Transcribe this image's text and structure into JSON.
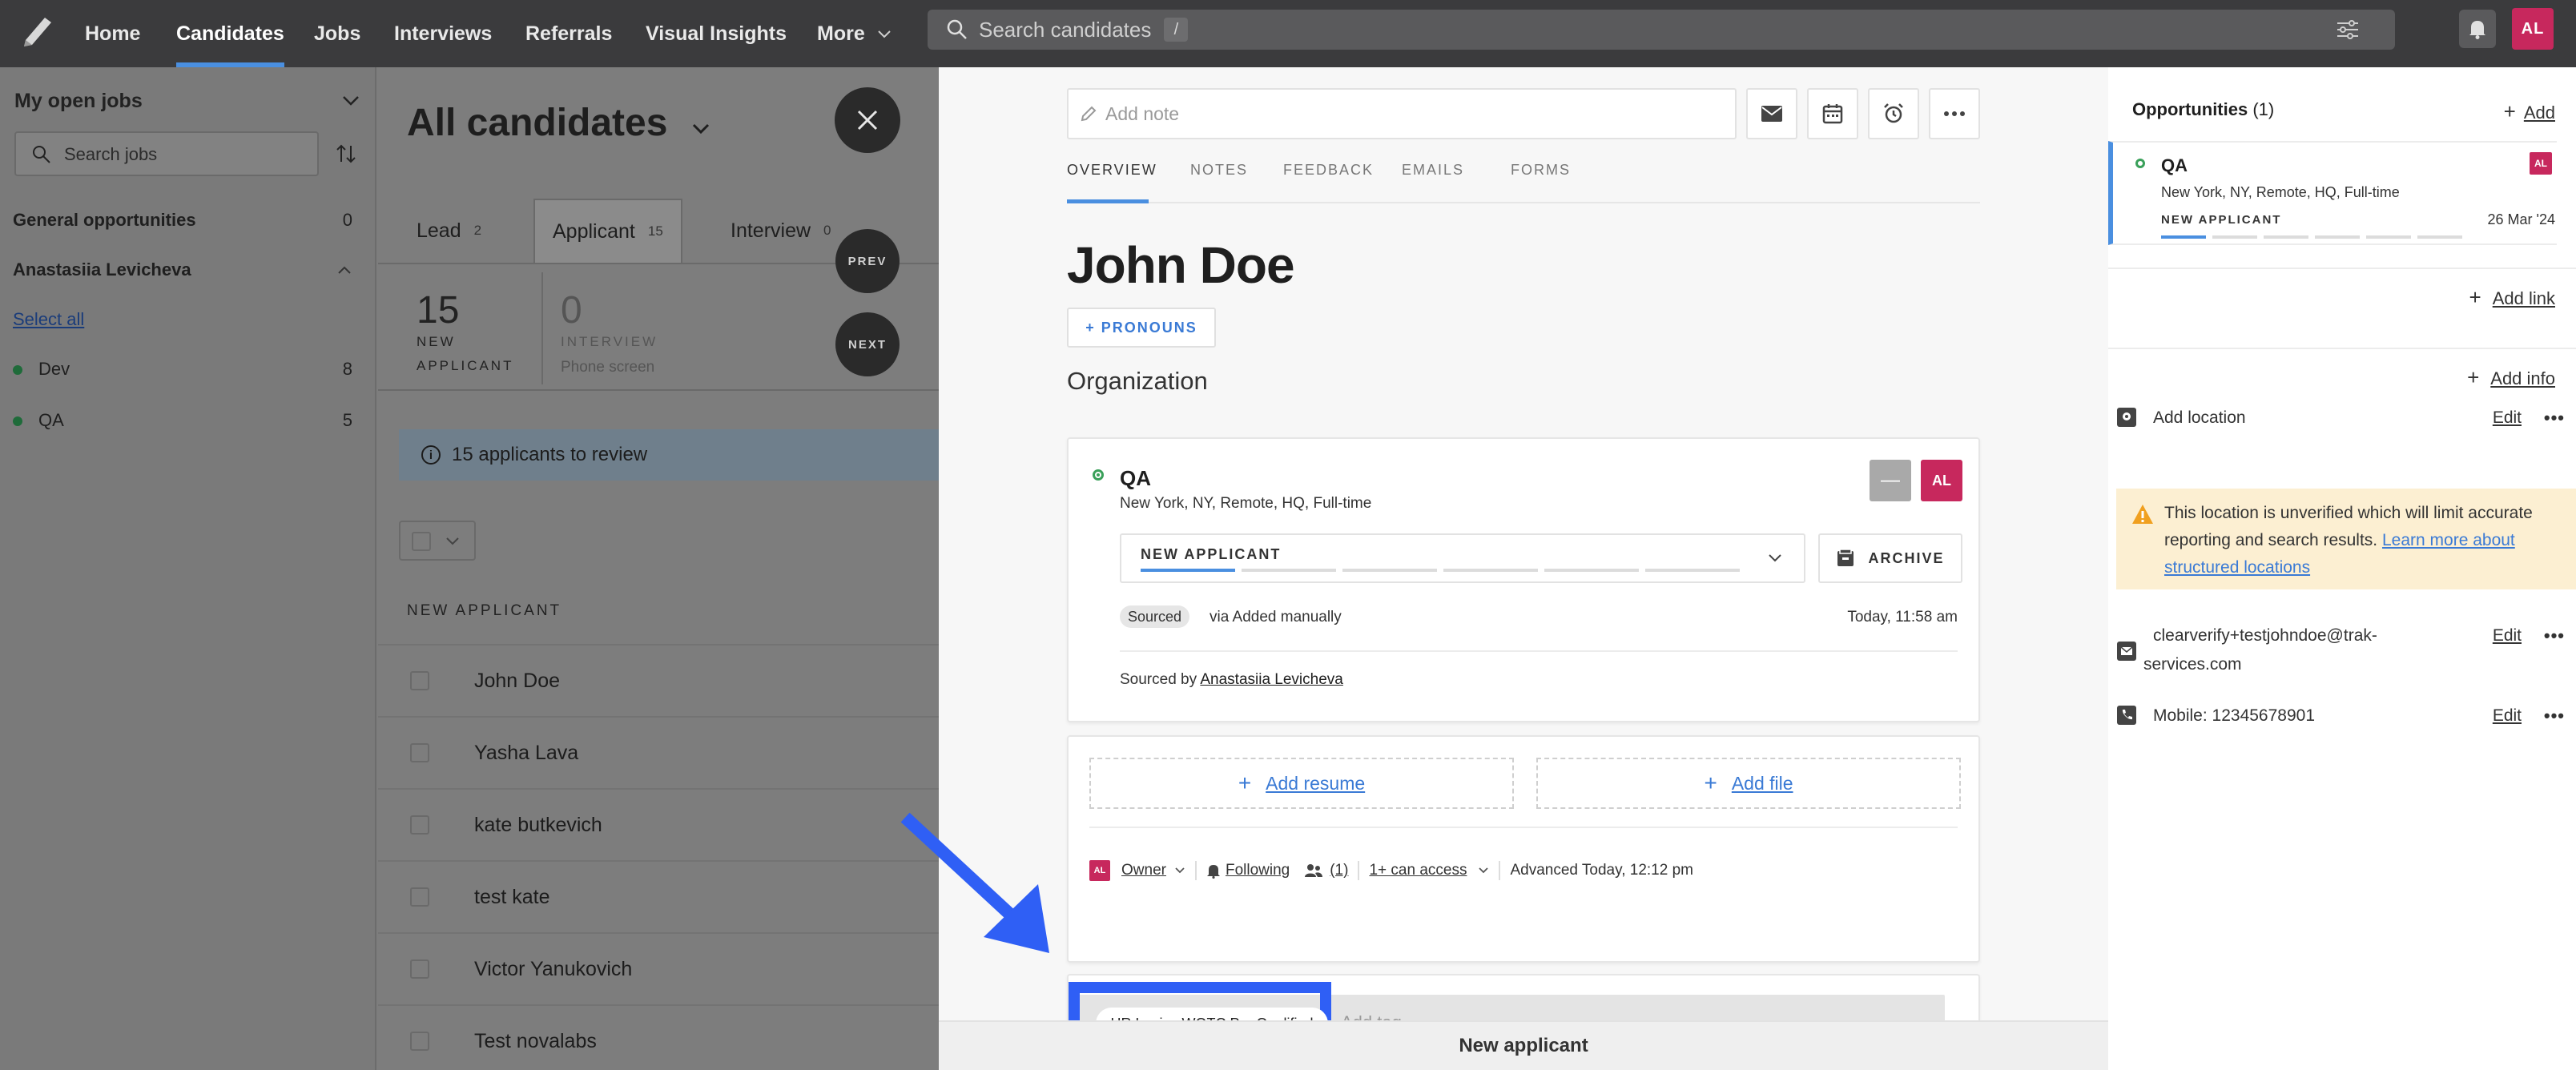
{
  "nav": {
    "items": [
      "Home",
      "Candidates",
      "Jobs",
      "Interviews",
      "Referrals",
      "Visual Insights",
      "More"
    ],
    "search_placeholder": "Search candidates",
    "search_shortcut": "/",
    "avatar_initials": "AL"
  },
  "sidebar": {
    "title": "My open jobs",
    "search_placeholder": "Search jobs",
    "general_label": "General opportunities",
    "general_count": "0",
    "owner_name": "Anastasiia Levicheva",
    "select_all": "Select all",
    "jobs": [
      {
        "name": "Dev",
        "count": "8"
      },
      {
        "name": "QA",
        "count": "5"
      }
    ]
  },
  "candidates_list": {
    "title": "All candidates",
    "tabs": [
      {
        "label": "Lead",
        "count": "2"
      },
      {
        "label": "Applicant",
        "count": "15"
      },
      {
        "label": "Interview",
        "count": "0"
      }
    ],
    "stat1_num": "15",
    "stat1_label_a": "NEW",
    "stat1_label_b": "APPLICANT",
    "stat2_num": "0",
    "stat2_label": "INTERVIEW",
    "stat2_sub": "Phone screen",
    "prev_label": "PREV",
    "next_label": "NEXT",
    "banner": "15 applicants to review",
    "section": "NEW APPLICANT",
    "rows": [
      "John Doe",
      "Yasha Lava",
      "kate butkevich",
      "test kate",
      "Victor Yanukovich",
      "Test novalabs"
    ]
  },
  "profile": {
    "add_note_placeholder": "Add note",
    "tabs": [
      "OVERVIEW",
      "NOTES",
      "FEEDBACK",
      "EMAILS",
      "FORMS"
    ],
    "name": "John Doe",
    "pronouns_label": "+ PRONOUNS",
    "organization": "Organization",
    "opportunity": {
      "title": "QA",
      "location": "New York, NY, Remote, HQ, Full-time",
      "stage": "NEW APPLICANT",
      "archive_label": "ARCHIVE",
      "source_badge": "Sourced",
      "source_via": "via Added manually",
      "timestamp": "Today, 11:58 am",
      "sourced_by_label": "Sourced by",
      "sourced_by_name": "Anastasiia Levicheva",
      "avatar_initials": "AL",
      "stage_progress": 0.167
    },
    "add_resume": "Add resume",
    "add_file": "Add file",
    "owner_label": "Owner",
    "following_label": "Following",
    "followers_count": "(1)",
    "access_label": "1+ can access",
    "advanced_label": "Advanced Today, 12:12 pm",
    "tag_chip": "HR Logics-WOTC:Pre Qualified",
    "add_tag_placeholder": "Add tag",
    "bottom_stage": "New applicant",
    "highlight_color": "#2f5ff5"
  },
  "right_panel": {
    "opportunities_label": "Opportunities",
    "opportunities_count": "(1)",
    "add_label": "Add",
    "opp_title": "QA",
    "opp_location": "New York, NY, Remote, HQ, Full-time",
    "opp_stage": "NEW APPLICANT",
    "opp_date": "26 Mar '24",
    "opp_avatar": "AL",
    "add_link": "Add link",
    "add_info": "Add info",
    "location_label": "Add location",
    "edit_label": "Edit",
    "warning_text": "This location is unverified which will limit accurate reporting and search results.",
    "warning_link": "Learn more about structured locations",
    "email_line1": "clearverify+testjohndoe@trak-",
    "email_line2": "services.com",
    "mobile": "Mobile: 12345678901",
    "more_label": "•••"
  },
  "colors": {
    "accent": "#4a8fe0",
    "brand_avatar": "#c7285d",
    "nav_bg": "#3b3b3d",
    "warning_bg": "#fcefd2"
  }
}
